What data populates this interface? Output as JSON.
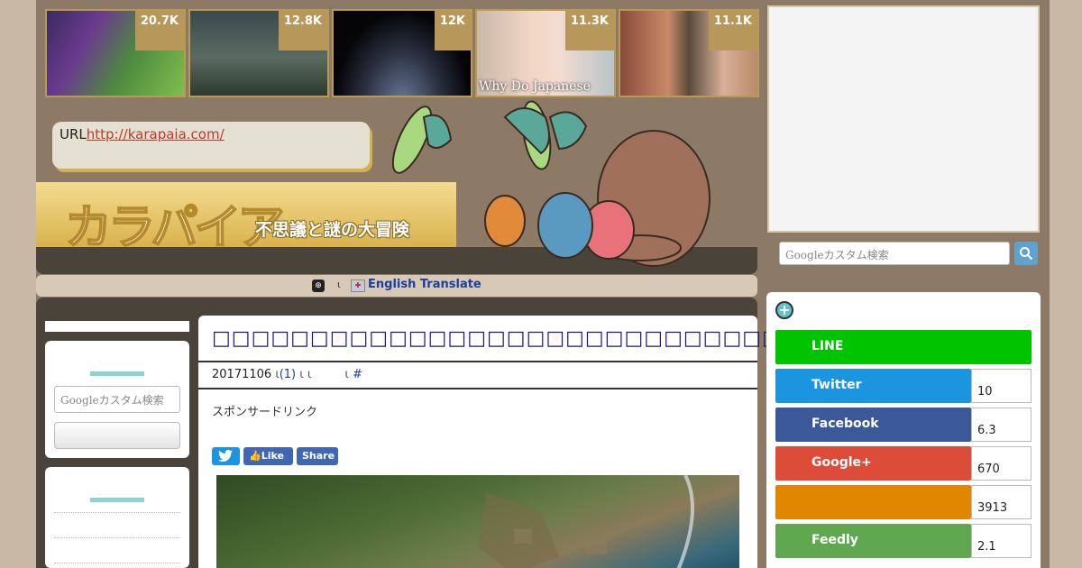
{
  "thumbnails": [
    {
      "count": "20.7K",
      "caption": ""
    },
    {
      "count": "12.8K",
      "caption": ""
    },
    {
      "count": "12K",
      "caption": ""
    },
    {
      "count": "11.3K",
      "caption": "Why Do Japanese"
    },
    {
      "count": "11.1K",
      "caption": ""
    }
  ],
  "header": {
    "url_label": "URL",
    "url_link": "http://karapaia.com/",
    "logo_text": "カラパイア",
    "tagline": "不思議と謎の大冒険"
  },
  "translate": {
    "link": "English Translate"
  },
  "left_sidebar": {
    "search_placeholder": "Googleカスタム検索"
  },
  "article": {
    "title": "□□□□□□□□□□□□□□□□□□□□□□□□□□□□□□□□□□□□□□□",
    "date": "20171106",
    "comments": "(1)",
    "hash": "#",
    "sponsor": "スポンサードリンク",
    "share_buttons": {
      "twitter": "",
      "like": "Like",
      "share": "Share"
    }
  },
  "right_sidebar": {
    "search_placeholder": "Googleカスタム検索",
    "social": [
      {
        "name": "LINE",
        "count": "",
        "color": "#00c300"
      },
      {
        "name": "Twitter",
        "count": "10",
        "color": "#1b95e0"
      },
      {
        "name": "Facebook",
        "count": "6.3",
        "color": "#3b5998"
      },
      {
        "name": "Google+",
        "count": "670",
        "color": "#dd4b39"
      },
      {
        "name": "",
        "count": "3913",
        "color": "#e08600"
      },
      {
        "name": "Feedly",
        "count": "2.1",
        "color": "#5fa84f"
      }
    ]
  }
}
